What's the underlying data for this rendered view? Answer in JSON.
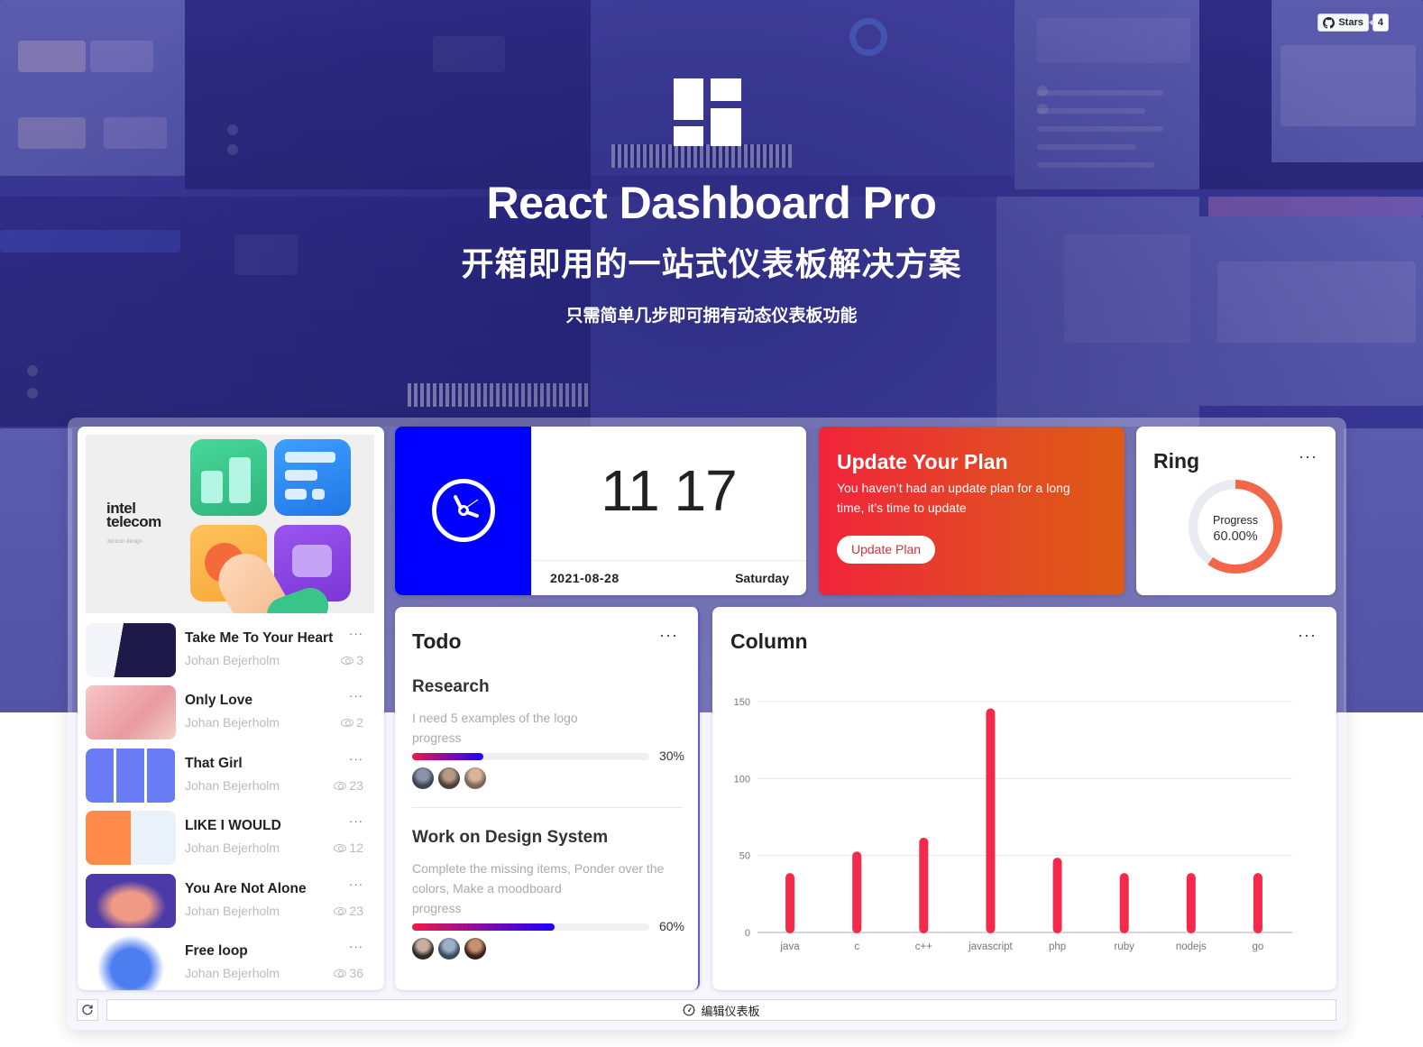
{
  "github_badge": {
    "label": "Stars",
    "count": "4",
    "icon": "github-icon"
  },
  "hero": {
    "title": "React Dashboard Pro",
    "subtitle": "开箱即用的一站式仪表板解决方案",
    "description": "只需简单几步即可拥有动态仪表板功能",
    "logo": "dashboard-layout-icon"
  },
  "media_list": {
    "banner": {
      "brand_line1": "intel",
      "brand_line2": "telecom",
      "caption": "3d icon design"
    },
    "items": [
      {
        "title": "Take Me To Your Heart",
        "author": "Johan Bejerholm",
        "views": "3"
      },
      {
        "title": "Only Love",
        "author": "Johan Bejerholm",
        "views": "2"
      },
      {
        "title": "That Girl",
        "author": "Johan Bejerholm",
        "views": "23"
      },
      {
        "title": "LIKE I WOULD",
        "author": "Johan Bejerholm",
        "views": "12"
      },
      {
        "title": "You Are Not Alone",
        "author": "Johan Bejerholm",
        "views": "23"
      },
      {
        "title": "Free loop",
        "author": "Johan Bejerholm",
        "views": "36"
      }
    ],
    "more_label": "···"
  },
  "clock": {
    "time": "11 17",
    "date": "2021-08-28",
    "weekday": "Saturday",
    "accent": "#0000ff"
  },
  "plan": {
    "title": "Update Your Plan",
    "text": "You haven’t had an update plan for a long time, it’s time to update",
    "button": "Update Plan"
  },
  "ring": {
    "title": "Ring",
    "label": "Progress",
    "value_text": "60.00%",
    "progress": 0.6,
    "color": "#f2674a",
    "track_color": "#e8ecf1",
    "more_label": "···"
  },
  "todo": {
    "title": "Todo",
    "more_label": "···",
    "tasks": [
      {
        "name": "Research",
        "description": "I need 5 examples of the logo",
        "progress_label": "progress",
        "progress": 30,
        "progress_text": "30%"
      },
      {
        "name": "Work on Design System",
        "description": "Complete the missing items, Ponder over the colors, Make a moodboard",
        "progress_label": "progress",
        "progress": 60,
        "progress_text": "60%"
      }
    ]
  },
  "column_card": {
    "title": "Column",
    "more_label": "···"
  },
  "chart_data": {
    "type": "bar",
    "title": "Column",
    "categories": [
      "java",
      "c",
      "c++",
      "javascript",
      "php",
      "ruby",
      "nodejs",
      "go"
    ],
    "values": [
      38,
      52,
      61,
      145,
      48,
      38,
      38,
      38
    ],
    "xlabel": "",
    "ylabel": "",
    "ylim": [
      0,
      150
    ],
    "yticks": [
      0,
      50,
      100,
      150
    ],
    "grid": true,
    "legend": "none",
    "bar_color": "#f5294a"
  },
  "footer": {
    "reload_icon": "reload-icon",
    "edit_label": "编辑仪表板",
    "edit_icon": "dashboard-gauge-icon"
  }
}
